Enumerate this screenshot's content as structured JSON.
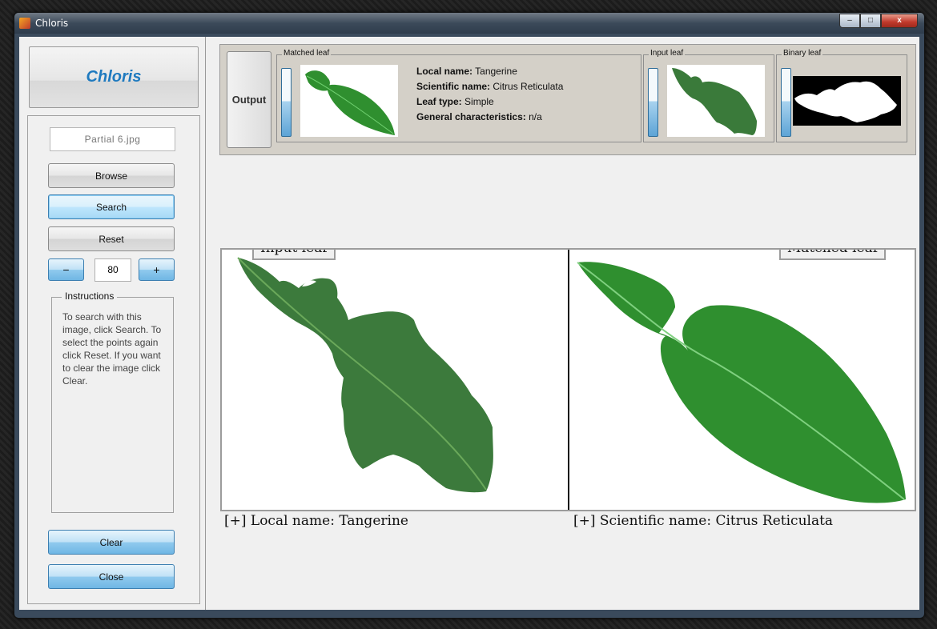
{
  "window": {
    "title": "Chloris",
    "minimize": "–",
    "maximize": "□",
    "close": "x"
  },
  "sidebar": {
    "brand": "Chloris",
    "file_field": "Partial 6.jpg",
    "browse_label": "Browse",
    "search_label": "Search",
    "reset_label": "Reset",
    "minus_label": "−",
    "plus_label": "+",
    "spin_value": "80",
    "instructions_title": "Instructions",
    "instructions_text": "To search with this image, click Search. To select the points again click Reset. If you want to clear the image click Clear.",
    "clear_label": "Clear",
    "close_label": "Close"
  },
  "output": {
    "button_label": "Output",
    "matched_group_title": "Matched leaf",
    "input_group_title": "Input leaf",
    "binary_group_title": "Binary leaf",
    "local_name_key": "Local name:",
    "local_name_value": "Tangerine",
    "scientific_name_key": "Scientific name:",
    "scientific_name_value": "Citrus Reticulata",
    "leaf_type_key": "Leaf type:",
    "leaf_type_value": "Simple",
    "general_key": "General characteristics:",
    "general_value": "n/a"
  },
  "comparison": {
    "input_label": "Input leaf",
    "matched_label": "Matched leaf",
    "left_caption": "[+] Local name: Tangerine",
    "right_caption": "[+] Scientific name: Citrus Reticulata"
  },
  "colors": {
    "brand": "#1f7abf",
    "leaf_dark": "#3a7a3a",
    "leaf_bright": "#2e9a2e",
    "panel": "#d4d0c8"
  }
}
